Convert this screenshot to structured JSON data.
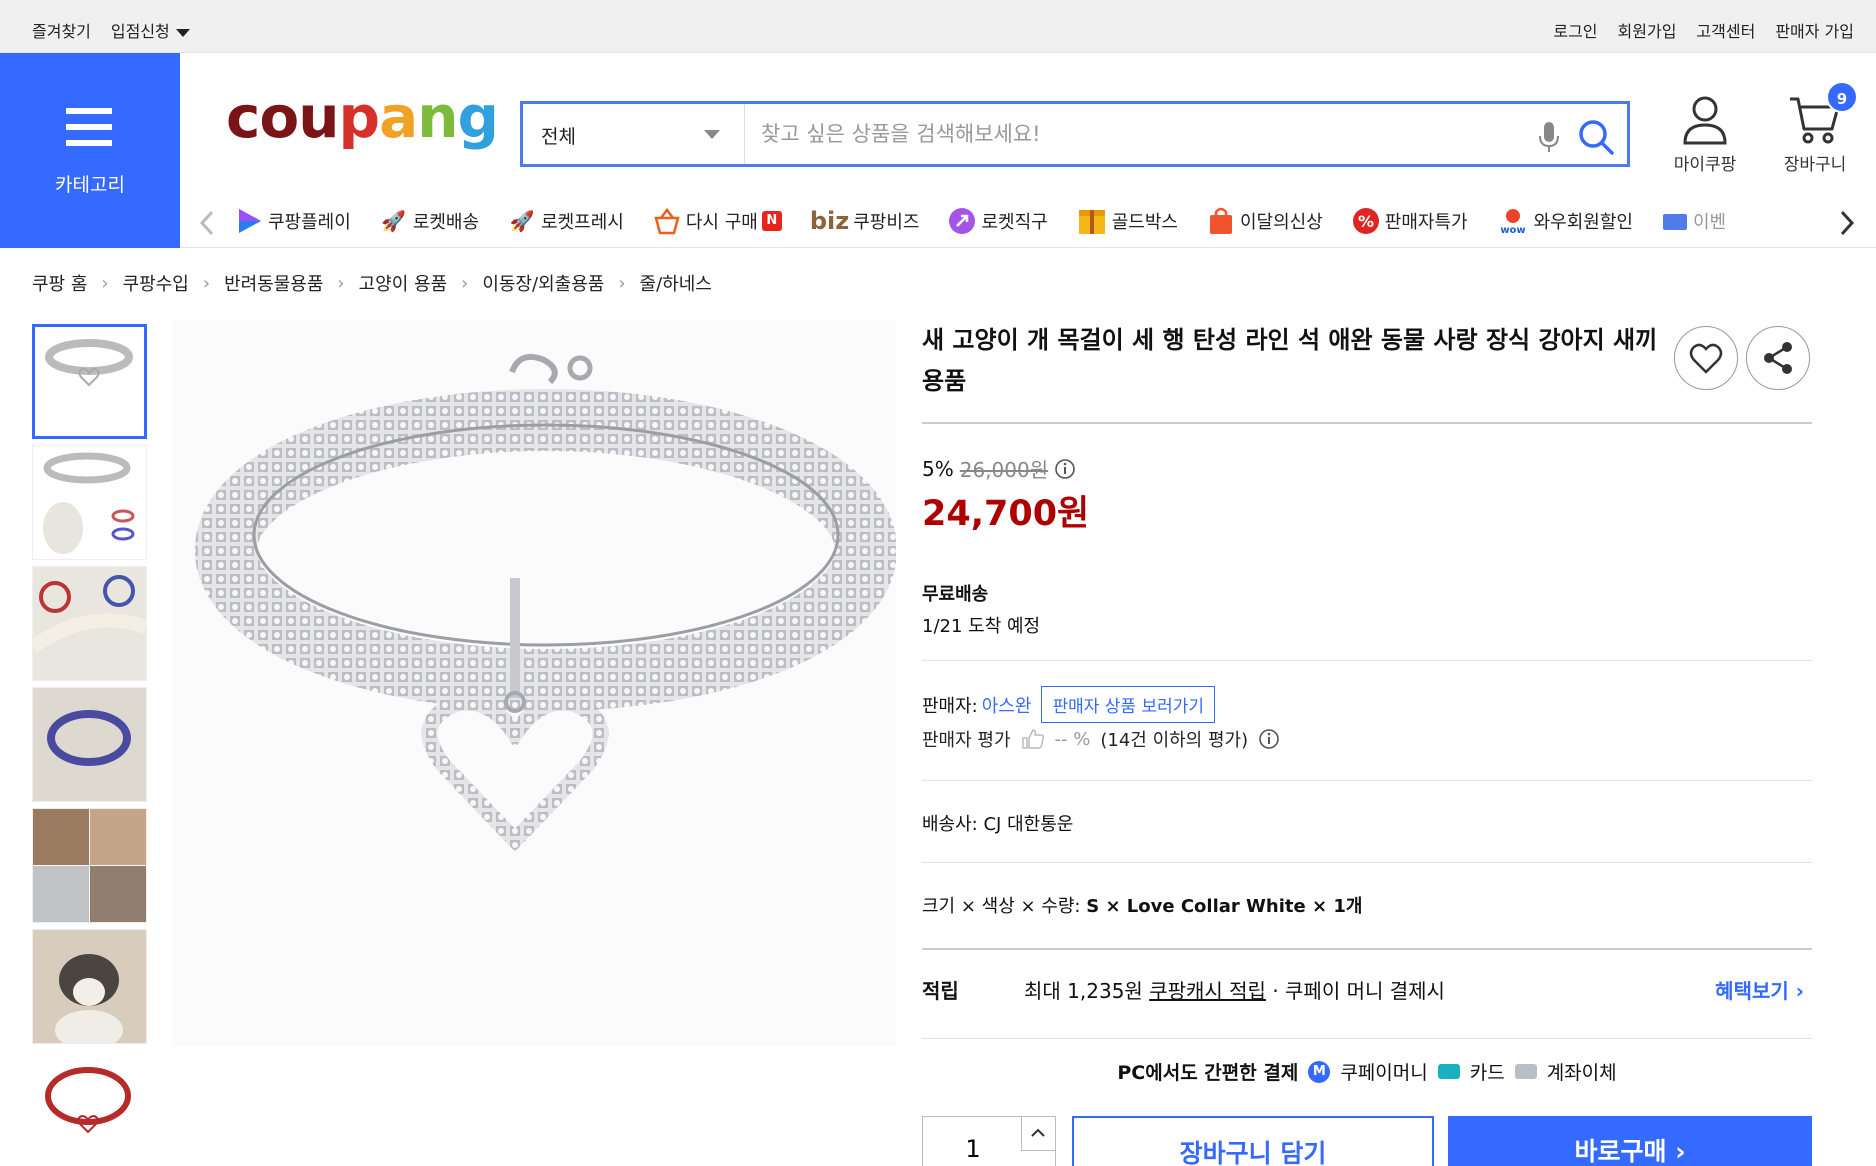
{
  "topbar": {
    "favorites": "즐겨찾기",
    "store_apply": "입점신청",
    "login": "로그인",
    "signup": "회원가입",
    "customer_center": "고객센터",
    "seller_signup": "판매자 가입"
  },
  "header": {
    "category_label": "카테고리",
    "logo": {
      "c1": "cou",
      "c2": "p",
      "c3": "a",
      "c4": "n",
      "c5": "g"
    },
    "search_scope": "전체",
    "search_placeholder": "찾고 싶은 상품을 검색해보세요!",
    "mycoupang": "마이쿠팡",
    "cart_label": "장바구니",
    "cart_count": "9"
  },
  "nav": {
    "items": [
      {
        "label": "쿠팡플레이",
        "icon": "play-icon"
      },
      {
        "label": "로켓배송",
        "icon": "rocket-icon"
      },
      {
        "label": "로켓프레시",
        "icon": "rocket-fresh-icon"
      },
      {
        "label": "다시 구매",
        "icon": "basket-icon"
      },
      {
        "prefix": "biz",
        "label": "쿠팡비즈",
        "icon": "biz-icon"
      },
      {
        "label": "로켓직구",
        "icon": "rocket-global-icon"
      },
      {
        "label": "골드박스",
        "icon": "goldbox-icon"
      },
      {
        "label": "이달의신상",
        "icon": "new-bag-icon"
      },
      {
        "label": "판매자특가",
        "icon": "percent-icon"
      },
      {
        "label": "와우회원할인",
        "icon": "wow-icon"
      },
      {
        "label": "이벤",
        "icon": "event-icon"
      }
    ]
  },
  "breadcrumb": [
    "쿠팡 홈",
    "쿠팡수입",
    "반려동물용품",
    "고양이 용품",
    "이동장/외출용품",
    "줄/하네스"
  ],
  "product": {
    "title": "새 고양이 개 목걸이 세 행 탄성 라인 석 애완 동물 사랑 장식 강아지 새끼 용품",
    "discount_rate": "5%",
    "original_price": "26,000원",
    "price": "24,700원",
    "shipping_type": "무료배송",
    "arrival": "1/21 도착 예정",
    "seller_label": "판매자:",
    "seller_name": "아스완",
    "seller_button": "판매자 상품 보러가기",
    "rating_label": "판매자 평가",
    "rating_value": "-- %",
    "rating_note": "(14건 이하의 평가)",
    "carrier_label": "배송사:",
    "carrier_name": "CJ 대한통운",
    "option_label": "크기 × 색상 × 수량:",
    "option_value": "S × Love Collar White × 1개",
    "reward_label": "적립",
    "reward_amount": "최대 1,235원",
    "reward_link": "쿠팡캐시 적립",
    "reward_note": "· 쿠페이 머니 결제시",
    "reward_more": "혜택보기",
    "pay_label": "PC에서도 간편한 결제",
    "pay_money": "쿠페이머니",
    "pay_card": "카드",
    "pay_bank": "계좌이체",
    "quantity": "1",
    "add_to_cart": "장바구니 담기",
    "buy_now": "바로구매"
  }
}
